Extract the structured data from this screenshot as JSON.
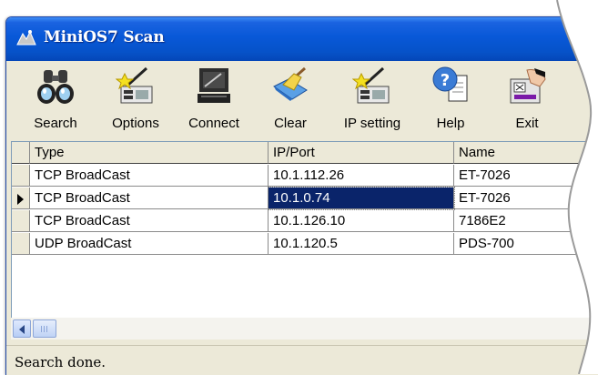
{
  "window": {
    "title": "MiniOS7 Scan"
  },
  "toolbar": {
    "buttons": [
      {
        "id": "search",
        "label": "Search",
        "icon": "binoculars-icon"
      },
      {
        "id": "options",
        "label": "Options",
        "icon": "wand-config-icon"
      },
      {
        "id": "connect",
        "label": "Connect",
        "icon": "computer-icon"
      },
      {
        "id": "clear",
        "label": "Clear",
        "icon": "broom-icon"
      },
      {
        "id": "ip_setting",
        "label": "IP setting",
        "icon": "wand-config-icon"
      },
      {
        "id": "help",
        "label": "Help",
        "icon": "help-icon"
      },
      {
        "id": "exit",
        "label": "Exit",
        "icon": "exit-icon"
      }
    ]
  },
  "grid": {
    "columns": [
      "Type",
      "IP/Port",
      "Name"
    ],
    "rows": [
      {
        "type": "TCP BroadCast",
        "ip": "10.1.112.26",
        "name": "ET-7026"
      },
      {
        "type": "TCP BroadCast",
        "ip": "10.1.0.74",
        "name": "ET-7026"
      },
      {
        "type": "TCP BroadCast",
        "ip": "10.1.126.10",
        "name": "7186E2"
      },
      {
        "type": "UDP BroadCast",
        "ip": "10.1.120.5",
        "name": "PDS-700"
      }
    ],
    "selected_row": 1
  },
  "status": {
    "text": "Search done."
  },
  "colors": {
    "titlebar": "#0858d8",
    "selection": "#0a246a",
    "face": "#ece9d8"
  }
}
